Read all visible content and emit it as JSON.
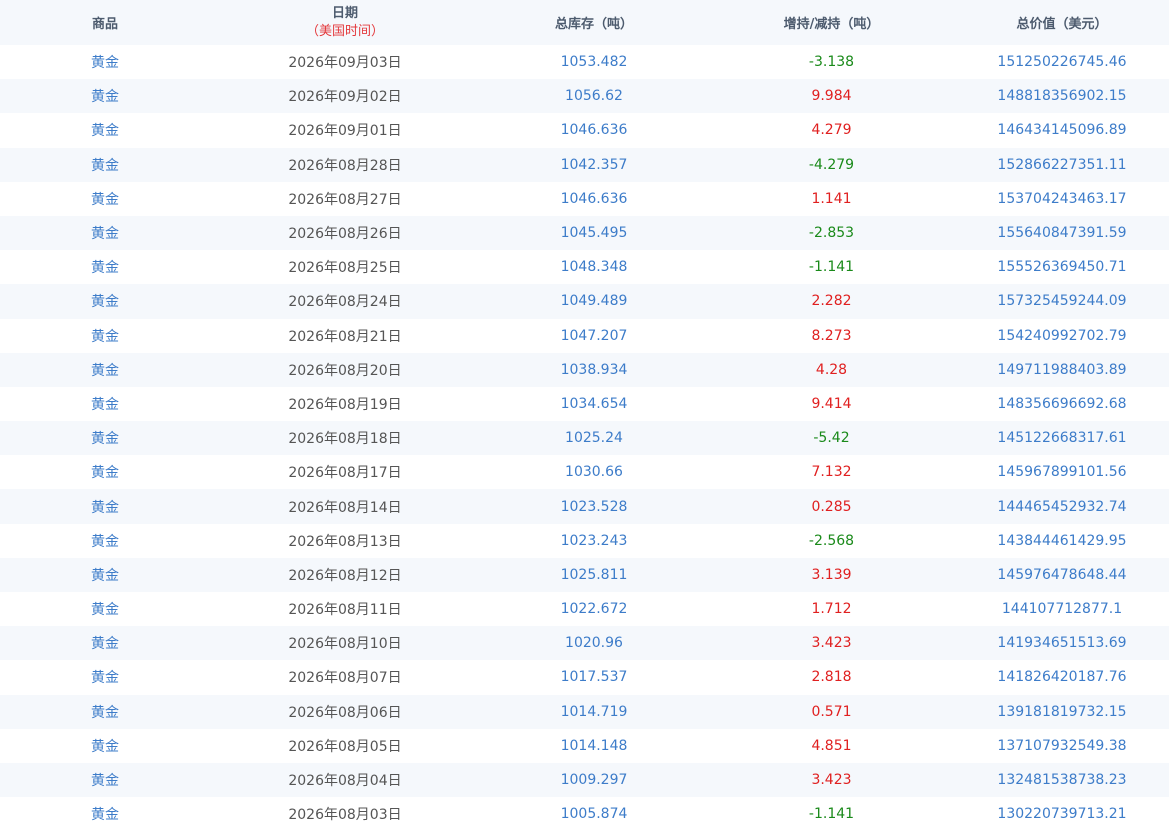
{
  "colors": {
    "header_bg": "#f5f8fc",
    "alt_row_bg": "#f5f8fc",
    "link_blue": "#3d7cc9",
    "increase_red": "#e02020",
    "decrease_green": "#1a8a1a",
    "subtitle_red": "#e4393c"
  },
  "table": {
    "headers": {
      "goods": "商品",
      "date": "日期",
      "date_sub": "（美国时间）",
      "total": "总库存（吨）",
      "change": "增持/减持（吨）",
      "value": "总价值（美元）"
    },
    "rows": [
      {
        "goods": "黄金",
        "date": "2026年09月03日",
        "total": "1053.482",
        "change": "-3.138",
        "value": "151250226745.46"
      },
      {
        "goods": "黄金",
        "date": "2026年09月02日",
        "total": "1056.62",
        "change": "9.984",
        "value": "148818356902.15"
      },
      {
        "goods": "黄金",
        "date": "2026年09月01日",
        "total": "1046.636",
        "change": "4.279",
        "value": "146434145096.89"
      },
      {
        "goods": "黄金",
        "date": "2026年08月28日",
        "total": "1042.357",
        "change": "-4.279",
        "value": "152866227351.11"
      },
      {
        "goods": "黄金",
        "date": "2026年08月27日",
        "total": "1046.636",
        "change": "1.141",
        "value": "153704243463.17"
      },
      {
        "goods": "黄金",
        "date": "2026年08月26日",
        "total": "1045.495",
        "change": "-2.853",
        "value": "155640847391.59"
      },
      {
        "goods": "黄金",
        "date": "2026年08月25日",
        "total": "1048.348",
        "change": "-1.141",
        "value": "155526369450.71"
      },
      {
        "goods": "黄金",
        "date": "2026年08月24日",
        "total": "1049.489",
        "change": "2.282",
        "value": "157325459244.09"
      },
      {
        "goods": "黄金",
        "date": "2026年08月21日",
        "total": "1047.207",
        "change": "8.273",
        "value": "154240992702.79"
      },
      {
        "goods": "黄金",
        "date": "2026年08月20日",
        "total": "1038.934",
        "change": "4.28",
        "value": "149711988403.89"
      },
      {
        "goods": "黄金",
        "date": "2026年08月19日",
        "total": "1034.654",
        "change": "9.414",
        "value": "148356696692.68"
      },
      {
        "goods": "黄金",
        "date": "2026年08月18日",
        "total": "1025.24",
        "change": "-5.42",
        "value": "145122668317.61"
      },
      {
        "goods": "黄金",
        "date": "2026年08月17日",
        "total": "1030.66",
        "change": "7.132",
        "value": "145967899101.56"
      },
      {
        "goods": "黄金",
        "date": "2026年08月14日",
        "total": "1023.528",
        "change": "0.285",
        "value": "144465452932.74"
      },
      {
        "goods": "黄金",
        "date": "2026年08月13日",
        "total": "1023.243",
        "change": "-2.568",
        "value": "143844461429.95"
      },
      {
        "goods": "黄金",
        "date": "2026年08月12日",
        "total": "1025.811",
        "change": "3.139",
        "value": "145976478648.44"
      },
      {
        "goods": "黄金",
        "date": "2026年08月11日",
        "total": "1022.672",
        "change": "1.712",
        "value": "144107712877.1"
      },
      {
        "goods": "黄金",
        "date": "2026年08月10日",
        "total": "1020.96",
        "change": "3.423",
        "value": "141934651513.69"
      },
      {
        "goods": "黄金",
        "date": "2026年08月07日",
        "total": "1017.537",
        "change": "2.818",
        "value": "141826420187.76"
      },
      {
        "goods": "黄金",
        "date": "2026年08月06日",
        "total": "1014.719",
        "change": "0.571",
        "value": "139181819732.15"
      },
      {
        "goods": "黄金",
        "date": "2026年08月05日",
        "total": "1014.148",
        "change": "4.851",
        "value": "137107932549.38"
      },
      {
        "goods": "黄金",
        "date": "2026年08月04日",
        "total": "1009.297",
        "change": "3.423",
        "value": "132481538738.23"
      },
      {
        "goods": "黄金",
        "date": "2026年08月03日",
        "total": "1005.874",
        "change": "-1.141",
        "value": "130220739713.21"
      }
    ]
  }
}
